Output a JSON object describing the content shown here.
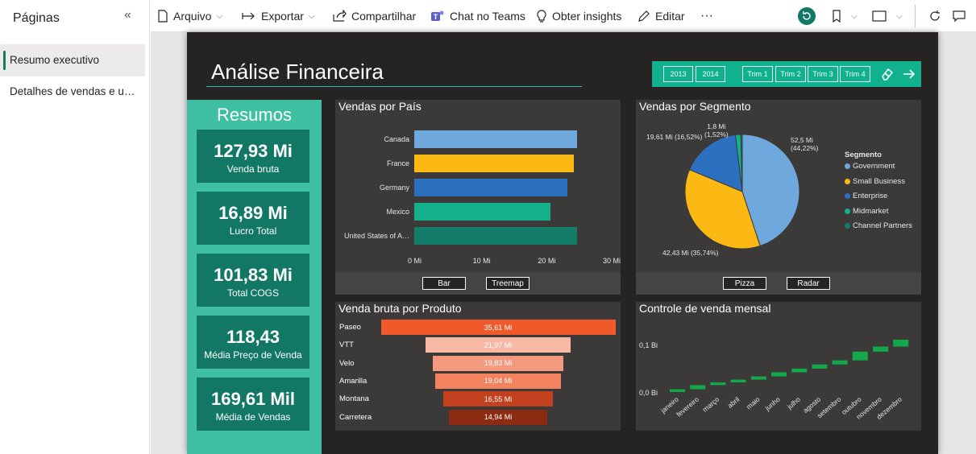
{
  "sidebar": {
    "title": "Páginas",
    "collapse_icon": "«",
    "items": [
      {
        "label": "Resumo executivo",
        "active": true
      },
      {
        "label": "Detalhes de vendas e u…",
        "active": false
      }
    ]
  },
  "toolbar": {
    "file": "Arquivo",
    "export": "Exportar",
    "share": "Compartilhar",
    "teams": "Chat no Teams",
    "insights": "Obter insights",
    "edit": "Editar",
    "more": "···"
  },
  "report": {
    "title": "Análise Financeira",
    "slicer": {
      "years": [
        "2013",
        "2014"
      ],
      "quarters": [
        "Trim 1",
        "Trim 2",
        "Trim 3",
        "Trim 4"
      ]
    },
    "summary": {
      "title": "Resumos",
      "kpis": [
        {
          "value": "127,93 Mi",
          "label": "Venda bruta"
        },
        {
          "value": "16,89 Mi",
          "label": "Lucro Total"
        },
        {
          "value": "101,83 Mi",
          "label": "Total COGS"
        },
        {
          "value": "118,43",
          "label": "Média Preço de Venda"
        },
        {
          "value": "169,61 Mil",
          "label": "Média de Vendas"
        }
      ]
    },
    "country_panel": {
      "title": "Vendas por País",
      "btn_bar": "Bar",
      "btn_treemap": "Treemap"
    },
    "segment_panel": {
      "title": "Vendas por Segmento",
      "legend_title": "Segmento",
      "btn_pie": "Pizza",
      "btn_radar": "Radar",
      "labels": {
        "government": "52,5 Mi\n(44,22%)",
        "small_business": "42,43 Mi (35,74%)",
        "enterprise": "19,61 Mi (16,52%)",
        "midmarket": "1,8 Mi\n(1,52%)"
      }
    },
    "product_panel": {
      "title": "Venda bruta por Produto"
    },
    "monthly_panel": {
      "title": "Controle de venda mensal"
    }
  },
  "chart_data": [
    {
      "type": "bar",
      "orientation": "horizontal",
      "title": "Vendas por País",
      "categories": [
        "Canada",
        "France",
        "Germany",
        "Mexico",
        "United States of A…"
      ],
      "values": [
        25,
        24.5,
        23.5,
        21,
        25.1
      ],
      "x_ticks": [
        "0 Mi",
        "10 Mi",
        "20 Mi",
        "30 Mi"
      ],
      "xlim": [
        0,
        30
      ],
      "colors": [
        "#6fa8dc",
        "#fdb913",
        "#2d6fbf",
        "#14b08c",
        "#147d6a"
      ]
    },
    {
      "type": "pie",
      "title": "Vendas por Segmento",
      "categories": [
        "Government",
        "Small Business",
        "Enterprise",
        "Midmarket",
        "Channel Partners"
      ],
      "values": [
        52.5,
        42.43,
        19.61,
        1.8,
        0.45
      ],
      "colors": [
        "#6fa8dc",
        "#fdb913",
        "#2d6fbf",
        "#14b08c",
        "#147d6a"
      ]
    },
    {
      "type": "bar",
      "subtype": "funnel",
      "title": "Venda bruta por Produto",
      "categories": [
        "Paseo",
        "VTT",
        "Velo",
        "Amarilla",
        "Montana",
        "Carretera"
      ],
      "values": [
        35.61,
        21.97,
        19.83,
        19.04,
        16.55,
        14.94
      ],
      "value_labels": [
        "35,61 Mi",
        "21,97 Mi",
        "19,83 Mi",
        "19,04 Mi",
        "16,55 Mi",
        "14,94 Mi"
      ],
      "colors": [
        "#f05a2a",
        "#f7b8a4",
        "#f39a7e",
        "#f3835f",
        "#c3411e",
        "#8c2a12"
      ]
    },
    {
      "type": "bar",
      "subtype": "waterfall",
      "title": "Controle de venda mensal",
      "categories": [
        "janeiro",
        "fevereiro",
        "março",
        "abril",
        "maio",
        "junho",
        "julho",
        "agosto",
        "setembro",
        "outubro",
        "novembro",
        "dezembro"
      ],
      "deltas": [
        0.006,
        0.009,
        0.006,
        0.006,
        0.007,
        0.009,
        0.008,
        0.009,
        0.009,
        0.019,
        0.011,
        0.015
      ],
      "y_ticks": [
        "0,1 Bi",
        "0,0 Bi"
      ],
      "color": "#13a84a"
    }
  ]
}
